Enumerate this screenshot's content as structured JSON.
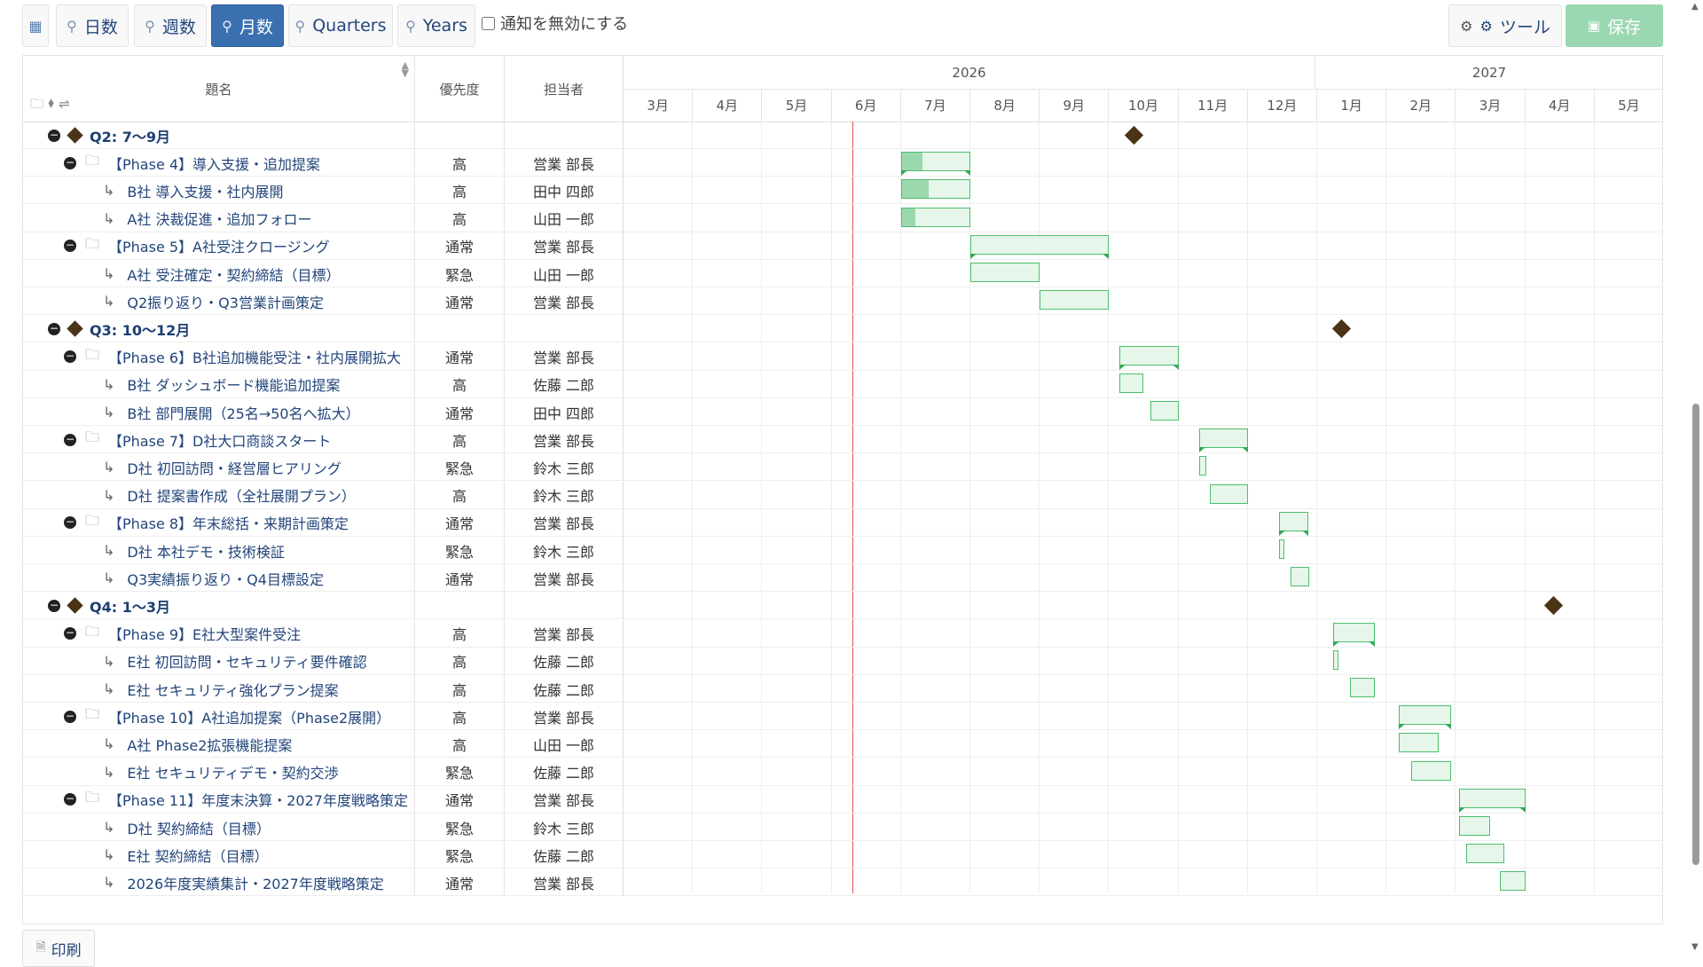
{
  "toolbar": {
    "days": "日数",
    "weeks": "週数",
    "months": "月数",
    "quarters": "Quarters",
    "years": "Years",
    "notify_label": "通知を無効にする",
    "tools": "ツール",
    "save": "保存"
  },
  "header": {
    "title_col": "題名",
    "priority_col": "優先度",
    "assignee_col": "担当者",
    "years": [
      "2026",
      "2027"
    ],
    "months": [
      "3月",
      "4月",
      "5月",
      "6月",
      "7月",
      "8月",
      "9月",
      "10月",
      "11月",
      "12月",
      "1月",
      "2月",
      "3月",
      "4月",
      "5月"
    ]
  },
  "print_label": "印刷",
  "rows": [
    {
      "type": "milestone",
      "title": "Q2: 7〜9月",
      "priority": "",
      "assignee": "",
      "ms": 7.35
    },
    {
      "type": "parent",
      "title": "【Phase 4】導入支援・追加提案",
      "priority": "高",
      "assignee": "営業 部長",
      "start": 4.0,
      "end": 5.0,
      "progress": 0.3
    },
    {
      "type": "task",
      "title": "B社 導入支援・社内展開",
      "priority": "高",
      "assignee": "田中 四郎",
      "start": 4.0,
      "end": 5.0,
      "progress": 0.4
    },
    {
      "type": "task",
      "title": "A社 決裁促進・追加フォロー",
      "priority": "高",
      "assignee": "山田 一郎",
      "start": 4.0,
      "end": 5.0,
      "progress": 0.2
    },
    {
      "type": "parent",
      "title": "【Phase 5】A社受注クロージング",
      "priority": "通常",
      "assignee": "営業 部長",
      "start": 5.0,
      "end": 7.0,
      "progress": 0
    },
    {
      "type": "task",
      "title": "A社 受注確定・契約締結（目標）",
      "priority": "緊急",
      "assignee": "山田 一郎",
      "start": 5.0,
      "end": 6.0,
      "progress": 0
    },
    {
      "type": "task",
      "title": "Q2振り返り・Q3営業計画策定",
      "priority": "通常",
      "assignee": "営業 部長",
      "start": 6.0,
      "end": 7.0,
      "progress": 0
    },
    {
      "type": "milestone",
      "title": "Q3: 10〜12月",
      "priority": "",
      "assignee": "",
      "ms": 10.35
    },
    {
      "type": "parent",
      "title": "【Phase 6】B社追加機能受注・社内展開拡大",
      "priority": "通常",
      "assignee": "営業 部長",
      "start": 7.15,
      "end": 8.0,
      "progress": 0
    },
    {
      "type": "task",
      "title": "B社 ダッシュボード機能追加提案",
      "priority": "高",
      "assignee": "佐藤 二郎",
      "start": 7.15,
      "end": 7.5,
      "progress": 0
    },
    {
      "type": "task",
      "title": "B社 部門展開（25名→50名へ拡大）",
      "priority": "通常",
      "assignee": "田中 四郎",
      "start": 7.6,
      "end": 8.0,
      "progress": 0
    },
    {
      "type": "parent",
      "title": "【Phase 7】D社大口商談スタート",
      "priority": "高",
      "assignee": "営業 部長",
      "start": 8.3,
      "end": 9.0,
      "progress": 0
    },
    {
      "type": "task",
      "title": "D社 初回訪問・経営層ヒアリング",
      "priority": "緊急",
      "assignee": "鈴木 三郎",
      "start": 8.3,
      "end": 8.4,
      "progress": 0
    },
    {
      "type": "task",
      "title": "D社 提案書作成（全社展開プラン）",
      "priority": "高",
      "assignee": "鈴木 三郎",
      "start": 8.45,
      "end": 9.0,
      "progress": 0
    },
    {
      "type": "parent",
      "title": "【Phase 8】年末総括・来期計画策定",
      "priority": "通常",
      "assignee": "営業 部長",
      "start": 9.45,
      "end": 9.87,
      "progress": 0
    },
    {
      "type": "task",
      "title": "D社 本社デモ・技術検証",
      "priority": "緊急",
      "assignee": "鈴木 三郎",
      "start": 9.45,
      "end": 9.5,
      "progress": 0
    },
    {
      "type": "task",
      "title": "Q3実績振り返り・Q4目標設定",
      "priority": "通常",
      "assignee": "営業 部長",
      "start": 9.62,
      "end": 9.88,
      "progress": 0
    },
    {
      "type": "milestone",
      "title": "Q4: 1〜3月",
      "priority": "",
      "assignee": "",
      "ms": 13.4
    },
    {
      "type": "parent",
      "title": "【Phase 9】E社大型案件受注",
      "priority": "高",
      "assignee": "営業 部長",
      "start": 10.23,
      "end": 10.83,
      "progress": 0
    },
    {
      "type": "task",
      "title": "E社 初回訪問・セキュリティ要件確認",
      "priority": "高",
      "assignee": "佐藤 二郎",
      "start": 10.23,
      "end": 10.3,
      "progress": 0
    },
    {
      "type": "task",
      "title": "E社 セキュリティ強化プラン提案",
      "priority": "高",
      "assignee": "佐藤 二郎",
      "start": 10.47,
      "end": 10.83,
      "progress": 0
    },
    {
      "type": "parent",
      "title": "【Phase 10】A社追加提案（Phase2展開）",
      "priority": "高",
      "assignee": "営業 部長",
      "start": 11.18,
      "end": 11.93,
      "progress": 0
    },
    {
      "type": "task",
      "title": "A社 Phase2拡張機能提案",
      "priority": "高",
      "assignee": "山田 一郎",
      "start": 11.18,
      "end": 11.75,
      "progress": 0
    },
    {
      "type": "task",
      "title": "E社 セキュリティデモ・契約交渉",
      "priority": "緊急",
      "assignee": "佐藤 二郎",
      "start": 11.35,
      "end": 11.93,
      "progress": 0
    },
    {
      "type": "parent",
      "title": "【Phase 11】年度末決算・2027年度戦略策定",
      "priority": "通常",
      "assignee": "営業 部長",
      "start": 12.05,
      "end": 13.0,
      "progress": 0
    },
    {
      "type": "task",
      "title": "D社 契約締結（目標）",
      "priority": "緊急",
      "assignee": "鈴木 三郎",
      "start": 12.05,
      "end": 12.5,
      "progress": 0
    },
    {
      "type": "task",
      "title": "E社 契約締結（目標）",
      "priority": "緊急",
      "assignee": "佐藤 二郎",
      "start": 12.15,
      "end": 12.7,
      "progress": 0
    },
    {
      "type": "task",
      "title": "2026年度実績集計・2027年度戦略策定",
      "priority": "通常",
      "assignee": "営業 部長",
      "start": 12.63,
      "end": 13.0,
      "progress": 0
    }
  ],
  "today_month": 3.3,
  "colors": {
    "accent": "#3a6fb0",
    "bar": "#e6f6ea",
    "bar_border": "#4cbf6c",
    "today": "#e05555",
    "milestone": "#4a3415"
  },
  "icons": {
    "calendar": "calendar-icon",
    "search": "search-icon",
    "gear": "gear-icon",
    "save": "save-icon",
    "folder": "folder-icon",
    "print": "print-icon"
  }
}
